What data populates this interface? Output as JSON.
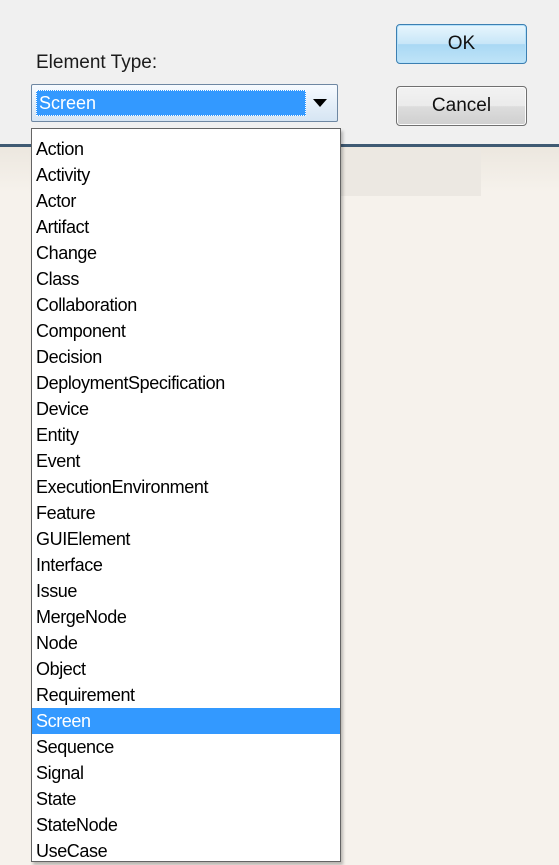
{
  "dialog": {
    "element_type_label": "Element Type:",
    "ok_label": "OK",
    "cancel_label": "Cancel"
  },
  "combo": {
    "selected_value": "Screen"
  },
  "dropdown": {
    "items": [
      "Action",
      "Activity",
      "Actor",
      "Artifact",
      "Change",
      "Class",
      "Collaboration",
      "Component",
      "Decision",
      "DeploymentSpecification",
      "Device",
      "Entity",
      "Event",
      "ExecutionEnvironment",
      "Feature",
      "GUIElement",
      "Interface",
      "Issue",
      "MergeNode",
      "Node",
      "Object",
      "Requirement",
      "Screen",
      "Sequence",
      "Signal",
      "State",
      "StateNode",
      "UseCase"
    ],
    "selected_item": "Screen"
  },
  "colors": {
    "selection": "#3399ff",
    "dialog_background": "#f0f0f0"
  },
  "icons": {
    "combo_arrow": "chevron-down-icon"
  }
}
